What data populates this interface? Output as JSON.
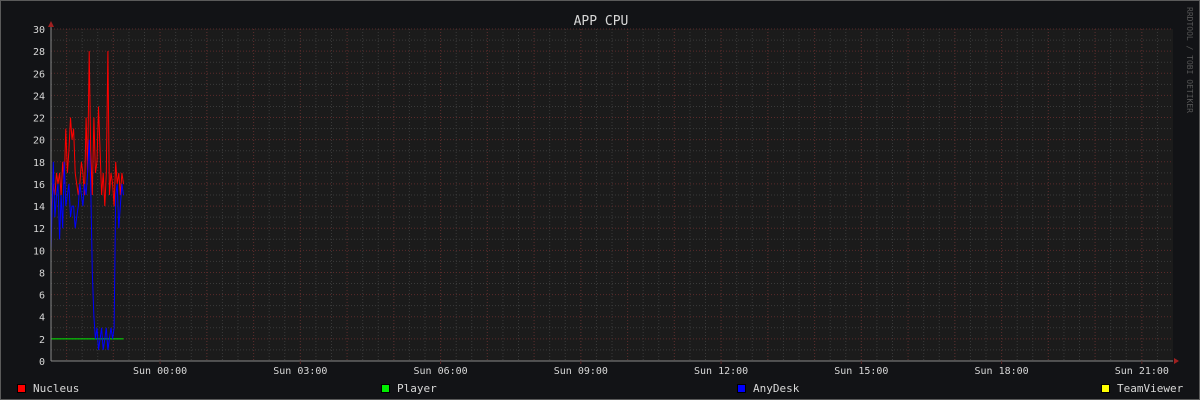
{
  "colors": {
    "background": "#121316",
    "plot_background": "#1b1b1b",
    "grid_minor": "#3a3a3a",
    "grid_major": "#5a2a2a",
    "text": "#d8d8d8",
    "axis": "#888888",
    "arrow": "#a02020",
    "watermark": "#555555"
  },
  "chart_data": {
    "type": "line",
    "title": "APP CPU",
    "watermark": "RRDTOOL / TOBI OETIKER",
    "xlabel": "",
    "ylabel": "",
    "ylim": [
      0,
      30
    ],
    "y_ticks": [
      0,
      2,
      4,
      6,
      8,
      10,
      12,
      14,
      16,
      18,
      20,
      22,
      24,
      26,
      28,
      30
    ],
    "x_unit": "minutes since the left edge of the plot",
    "xlim": [
      0,
      1440
    ],
    "x_ticks": [
      {
        "label": "Sun 00:00",
        "x": 140
      },
      {
        "label": "Sun 03:00",
        "x": 320
      },
      {
        "label": "Sun 06:00",
        "x": 500
      },
      {
        "label": "Sun 09:00",
        "x": 680
      },
      {
        "label": "Sun 12:00",
        "x": 860
      },
      {
        "label": "Sun 15:00",
        "x": 1040
      },
      {
        "label": "Sun 18:00",
        "x": 1220
      },
      {
        "label": "Sun 21:00",
        "x": 1400
      }
    ],
    "grid": true,
    "legend_position": "bottom",
    "series": [
      {
        "name": "Nucleus",
        "color": "#ff0000",
        "x": [
          0,
          3,
          5,
          7,
          9,
          11,
          13,
          15,
          17,
          19,
          21,
          23,
          25,
          27,
          29,
          31,
          33,
          35,
          37,
          39,
          41,
          43,
          45,
          47,
          49,
          51,
          53,
          55,
          57,
          59,
          61,
          63,
          65,
          67,
          69,
          71,
          73,
          75,
          77,
          79,
          81,
          83,
          85,
          87,
          89,
          91,
          93
        ],
        "values": [
          13,
          16,
          15,
          17,
          16,
          17,
          15,
          18,
          16,
          21,
          17,
          19,
          22,
          20,
          21,
          17,
          16,
          15,
          16,
          18,
          17,
          15,
          22,
          17,
          28,
          19,
          15,
          22,
          17,
          18,
          23,
          19,
          15,
          17,
          14,
          17,
          28,
          15,
          17,
          16,
          14,
          18,
          16,
          17,
          15,
          17,
          16
        ]
      },
      {
        "name": "Player",
        "color": "#00ee00",
        "x": [
          0,
          93
        ],
        "values": [
          2,
          2
        ]
      },
      {
        "name": "AnyDesk",
        "color": "#0000ff",
        "x": [
          0,
          3,
          5,
          7,
          9,
          11,
          13,
          15,
          17,
          19,
          21,
          23,
          25,
          27,
          29,
          31,
          33,
          35,
          37,
          39,
          41,
          43,
          45,
          47,
          49,
          51,
          53,
          55,
          57,
          59,
          61,
          63,
          65,
          67,
          69,
          71,
          73,
          75,
          77,
          79,
          81,
          83,
          85,
          87,
          89,
          91,
          93
        ],
        "values": [
          10,
          18,
          13,
          15,
          16,
          11,
          15,
          12,
          18,
          14,
          15,
          16,
          13,
          14,
          14,
          12,
          13,
          14,
          16,
          15,
          14,
          16,
          15,
          17,
          20,
          16,
          8,
          4,
          2,
          3,
          1,
          2,
          3,
          1,
          2,
          3,
          1,
          2,
          3,
          2,
          3,
          15,
          16,
          12,
          14,
          16,
          15
        ]
      },
      {
        "name": "TeamViewer",
        "color": "#ffff00",
        "x": [
          0,
          93
        ],
        "values": [
          0,
          0
        ]
      }
    ]
  }
}
